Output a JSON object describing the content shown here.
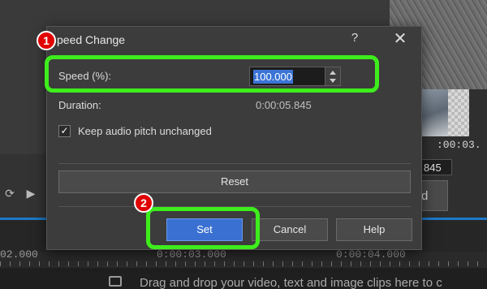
{
  "dialog": {
    "title": "peed Change",
    "help_glyph": "?",
    "close_glyph": "✕",
    "speed_label": "Speed (%):",
    "speed_value": "100.000",
    "duration_label": "Duration:",
    "duration_value": "0:00:05.845",
    "keep_pitch_label": "Keep audio pitch unchanged",
    "keep_pitch_checked": true,
    "reset_label": "Reset",
    "set_label": "Set",
    "cancel_label": "Cancel",
    "help_label": "Help"
  },
  "annotations": {
    "badge_1": "1",
    "badge_2": "2",
    "highlight_color": "#3dee1c",
    "badge_color": "#e00000"
  },
  "background": {
    "right_timecode": ":00:03.",
    "timecode_field": "845",
    "d_button": "d",
    "ruler_labels": [
      "02.000",
      "0:00:03.000",
      "0:00:04.000"
    ],
    "drop_hint": "Drag and drop your video, text and image clips here to c"
  },
  "colors": {
    "accent": "#3a70d2",
    "timeline_line": "#1b79c9"
  }
}
